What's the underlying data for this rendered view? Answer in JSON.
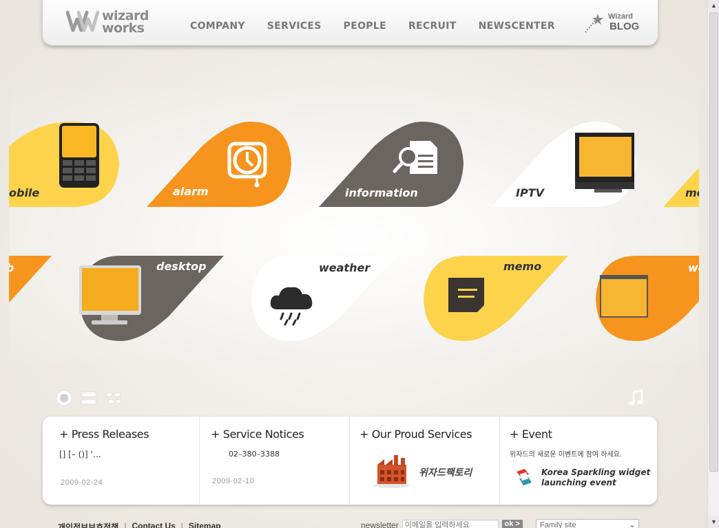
{
  "header": {
    "logo_line1": "wizard",
    "logo_line2": "works",
    "nav": [
      "COMPANY",
      "SERVICES",
      "PEOPLE",
      "RECRUIT",
      "NEWSCENTER"
    ],
    "blog_small": "Wizard",
    "blog_big": "BLOG"
  },
  "widgets_row1": [
    "obile",
    "alarm",
    "information",
    "IPTV",
    "mo"
  ],
  "widgets_row2": [
    "b",
    "desktop",
    "weather",
    "memo",
    "web"
  ],
  "colors": {
    "orange": "#f7941d",
    "yellow": "#fdd34c",
    "gray": "#6b6560",
    "white": "#ffffff"
  },
  "panel": {
    "press": {
      "title": "+ Press Releases",
      "text": "[] [– ()] '…",
      "date": "2009-02-24"
    },
    "notices": {
      "title": "+ Service Notices",
      "text": "02–380–3388",
      "date": "2009-02-10"
    },
    "services": {
      "title": "+ Our Proud Services",
      "item": "위자드팩토리"
    },
    "event": {
      "title": "+ Event",
      "desc": "위자드의 새로운 이벤트에 참여 하세요.",
      "item_line1": "Korea Sparkling widget",
      "item_line2": "launching event"
    }
  },
  "footer": {
    "privacy": "개인정보보호정책",
    "contact": "Contact Us",
    "sitemap": "Sitemap",
    "newsletter_label": "newsletter",
    "newsletter_placeholder": "이메일을 입력하세요",
    "ok": "ok >",
    "family_site": "Family site"
  }
}
